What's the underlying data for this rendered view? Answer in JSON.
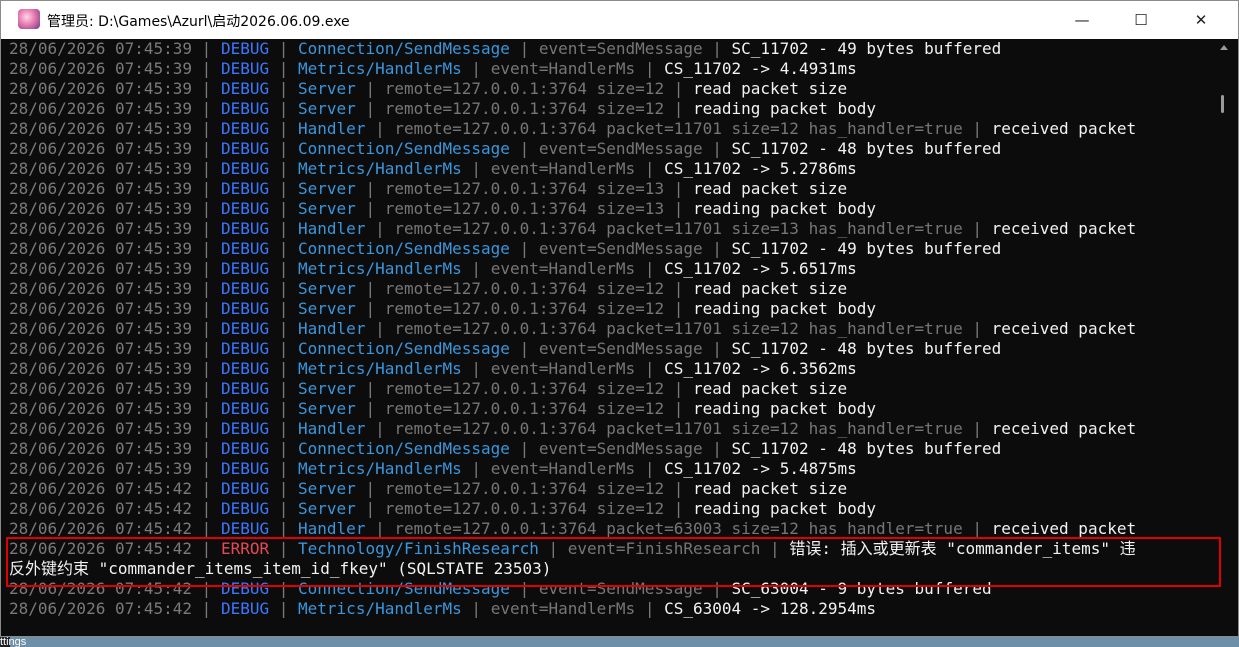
{
  "window": {
    "title": "管理员: D:\\Games\\Azurl\\启动2026.06.09.exe",
    "minimize": "—",
    "maximize": "☐",
    "close": "✕"
  },
  "desktop_label": "ttings",
  "log_lines": [
    {
      "ts": "28/06/2026 07:45:39",
      "level": "DEBUG",
      "src": "Connection/SendMessage",
      "kv": "event=SendMessage",
      "msg": "SC_11702 - 49 bytes buffered"
    },
    {
      "ts": "28/06/2026 07:45:39",
      "level": "DEBUG",
      "src": "Metrics/HandlerMs",
      "kv": "event=HandlerMs",
      "msg": "CS_11702 -> 4.4931ms"
    },
    {
      "ts": "28/06/2026 07:45:39",
      "level": "DEBUG",
      "src": "Server",
      "kv": "remote=127.0.0.1:3764 size=12",
      "msg": "read packet size"
    },
    {
      "ts": "28/06/2026 07:45:39",
      "level": "DEBUG",
      "src": "Server",
      "kv": "remote=127.0.0.1:3764 size=12",
      "msg": "reading packet body"
    },
    {
      "ts": "28/06/2026 07:45:39",
      "level": "DEBUG",
      "src": "Handler",
      "kv": "remote=127.0.0.1:3764 packet=11701 size=12 has_handler=true",
      "msg": "received packet"
    },
    {
      "ts": "28/06/2026 07:45:39",
      "level": "DEBUG",
      "src": "Connection/SendMessage",
      "kv": "event=SendMessage",
      "msg": "SC_11702 - 48 bytes buffered"
    },
    {
      "ts": "28/06/2026 07:45:39",
      "level": "DEBUG",
      "src": "Metrics/HandlerMs",
      "kv": "event=HandlerMs",
      "msg": "CS_11702 -> 5.2786ms"
    },
    {
      "ts": "28/06/2026 07:45:39",
      "level": "DEBUG",
      "src": "Server",
      "kv": "remote=127.0.0.1:3764 size=13",
      "msg": "read packet size"
    },
    {
      "ts": "28/06/2026 07:45:39",
      "level": "DEBUG",
      "src": "Server",
      "kv": "remote=127.0.0.1:3764 size=13",
      "msg": "reading packet body"
    },
    {
      "ts": "28/06/2026 07:45:39",
      "level": "DEBUG",
      "src": "Handler",
      "kv": "remote=127.0.0.1:3764 packet=11701 size=13 has_handler=true",
      "msg": "received packet"
    },
    {
      "ts": "28/06/2026 07:45:39",
      "level": "DEBUG",
      "src": "Connection/SendMessage",
      "kv": "event=SendMessage",
      "msg": "SC_11702 - 49 bytes buffered"
    },
    {
      "ts": "28/06/2026 07:45:39",
      "level": "DEBUG",
      "src": "Metrics/HandlerMs",
      "kv": "event=HandlerMs",
      "msg": "CS_11702 -> 5.6517ms"
    },
    {
      "ts": "28/06/2026 07:45:39",
      "level": "DEBUG",
      "src": "Server",
      "kv": "remote=127.0.0.1:3764 size=12",
      "msg": "read packet size"
    },
    {
      "ts": "28/06/2026 07:45:39",
      "level": "DEBUG",
      "src": "Server",
      "kv": "remote=127.0.0.1:3764 size=12",
      "msg": "reading packet body"
    },
    {
      "ts": "28/06/2026 07:45:39",
      "level": "DEBUG",
      "src": "Handler",
      "kv": "remote=127.0.0.1:3764 packet=11701 size=12 has_handler=true",
      "msg": "received packet"
    },
    {
      "ts": "28/06/2026 07:45:39",
      "level": "DEBUG",
      "src": "Connection/SendMessage",
      "kv": "event=SendMessage",
      "msg": "SC_11702 - 48 bytes buffered"
    },
    {
      "ts": "28/06/2026 07:45:39",
      "level": "DEBUG",
      "src": "Metrics/HandlerMs",
      "kv": "event=HandlerMs",
      "msg": "CS_11702 -> 6.3562ms"
    },
    {
      "ts": "28/06/2026 07:45:39",
      "level": "DEBUG",
      "src": "Server",
      "kv": "remote=127.0.0.1:3764 size=12",
      "msg": "read packet size"
    },
    {
      "ts": "28/06/2026 07:45:39",
      "level": "DEBUG",
      "src": "Server",
      "kv": "remote=127.0.0.1:3764 size=12",
      "msg": "reading packet body"
    },
    {
      "ts": "28/06/2026 07:45:39",
      "level": "DEBUG",
      "src": "Handler",
      "kv": "remote=127.0.0.1:3764 packet=11701 size=12 has_handler=true",
      "msg": "received packet"
    },
    {
      "ts": "28/06/2026 07:45:39",
      "level": "DEBUG",
      "src": "Connection/SendMessage",
      "kv": "event=SendMessage",
      "msg": "SC_11702 - 48 bytes buffered"
    },
    {
      "ts": "28/06/2026 07:45:39",
      "level": "DEBUG",
      "src": "Metrics/HandlerMs",
      "kv": "event=HandlerMs",
      "msg": "CS_11702 -> 5.4875ms"
    },
    {
      "ts": "28/06/2026 07:45:42",
      "level": "DEBUG",
      "src": "Server",
      "kv": "remote=127.0.0.1:3764 size=12",
      "msg": "read packet size"
    },
    {
      "ts": "28/06/2026 07:45:42",
      "level": "DEBUG",
      "src": "Server",
      "kv": "remote=127.0.0.1:3764 size=12",
      "msg": "reading packet body"
    },
    {
      "ts": "28/06/2026 07:45:42",
      "level": "DEBUG",
      "src": "Handler",
      "kv": "remote=127.0.0.1:3764 packet=63003 size=12 has_handler=true",
      "msg": "received packet"
    },
    {
      "ts": "28/06/2026 07:45:42",
      "level": "ERROR",
      "src": "Technology/FinishResearch",
      "kv": "event=FinishResearch",
      "msg": "错误: 插入或更新表 \"commander_items\" 违"
    },
    {
      "cont": "反外键约束 \"commander_items_item_id_fkey\" (SQLSTATE 23503)"
    },
    {
      "ts": "28/06/2026 07:45:42",
      "level": "DEBUG",
      "src": "Connection/SendMessage",
      "kv": "event=SendMessage",
      "msg": "SC_63004 - 9 bytes buffered"
    },
    {
      "ts": "28/06/2026 07:45:42",
      "level": "DEBUG",
      "src": "Metrics/HandlerMs",
      "kv": "event=HandlerMs",
      "msg": "CS_63004 -> 128.2954ms"
    }
  ],
  "colors": {
    "console_bg": "#0c0c0c",
    "debug": "#3b78ff",
    "error": "#e74856",
    "source": "#3a96dd",
    "highlight_box": "#e00000"
  }
}
